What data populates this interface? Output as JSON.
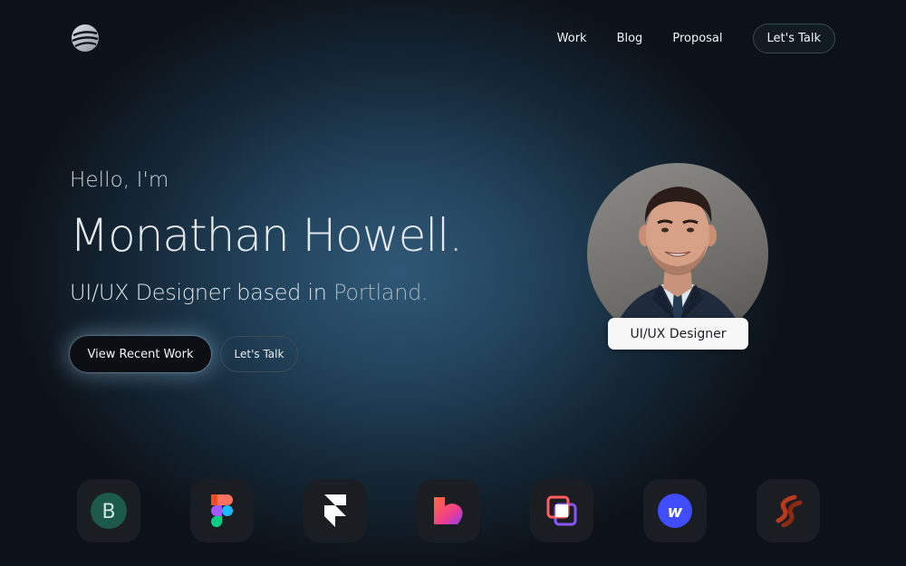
{
  "nav": {
    "links": [
      "Work",
      "Blog",
      "Proposal"
    ],
    "cta_label": "Let's Talk"
  },
  "hero": {
    "greeting": "Hello, I'm",
    "name": "Monathan Howell",
    "name_suffix": ".",
    "subtitle_prefix": "UI/UX Designer based in",
    "subtitle_city": "Portland.",
    "primary_button": "View Recent Work",
    "secondary_button": "Let's Talk"
  },
  "profile": {
    "role_badge": "UI/UX Designer"
  },
  "tools": [
    {
      "icon": "brand-b-icon",
      "letter": "B"
    },
    {
      "icon": "figma-icon"
    },
    {
      "icon": "framer-icon"
    },
    {
      "icon": "heart-logo-icon"
    },
    {
      "icon": "overlapping-squares-icon"
    },
    {
      "icon": "webflow-icon",
      "letter": "w"
    },
    {
      "icon": "curved-stripes-icon"
    }
  ],
  "colors": {
    "accent_blue": "#2f5876",
    "background": "#0d1218",
    "badge_bg": "#f7f7f7"
  }
}
